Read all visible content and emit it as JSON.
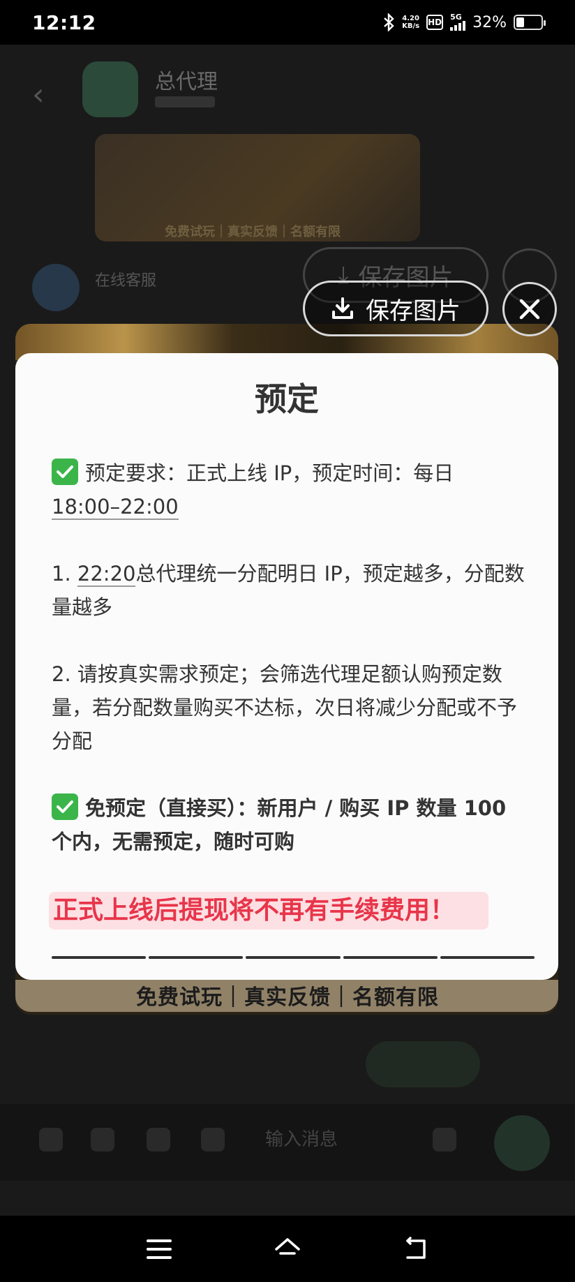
{
  "status_bar": {
    "time": "12:12",
    "net_speed_value": "4.20",
    "net_speed_unit": "KB/s",
    "hd_label": "HD",
    "network_label": "5G",
    "battery_text": "32%",
    "battery_level": 0.32
  },
  "background": {
    "chat_title": "总代理",
    "banner_tagline": "免费试玩｜真实反馈｜名额有限",
    "agent_name": "在线客服",
    "input_placeholder": "输入消息"
  },
  "overlay": {
    "save_label": "保存图片",
    "card": {
      "title": "预定",
      "p1_prefix": "预定要求：正式上线 IP，预定时间：每日",
      "p1_time": "18:00–22:00",
      "p2_number": "1.",
      "p2_time": "22:20",
      "p2_rest": "总代理统一分配明日 IP，预定越多，分配数量越多",
      "p3": "2. 请按真实需求预定；会筛选代理足额认购预定数量，若分配数量购买不达标，次日将减少分配或不予分配",
      "p4": "免预定（直接买）：新用户 / 购买 IP 数量 100 个内，无需预定，随时可购",
      "highlight": "正式上线后提现将不再有手续费用！"
    },
    "below_text": "免费试玩｜真实反馈｜名额有限"
  },
  "colors": {
    "check_green": "#3bb54a",
    "highlight_red": "#e8354a",
    "highlight_bg": "#fde0e3"
  }
}
